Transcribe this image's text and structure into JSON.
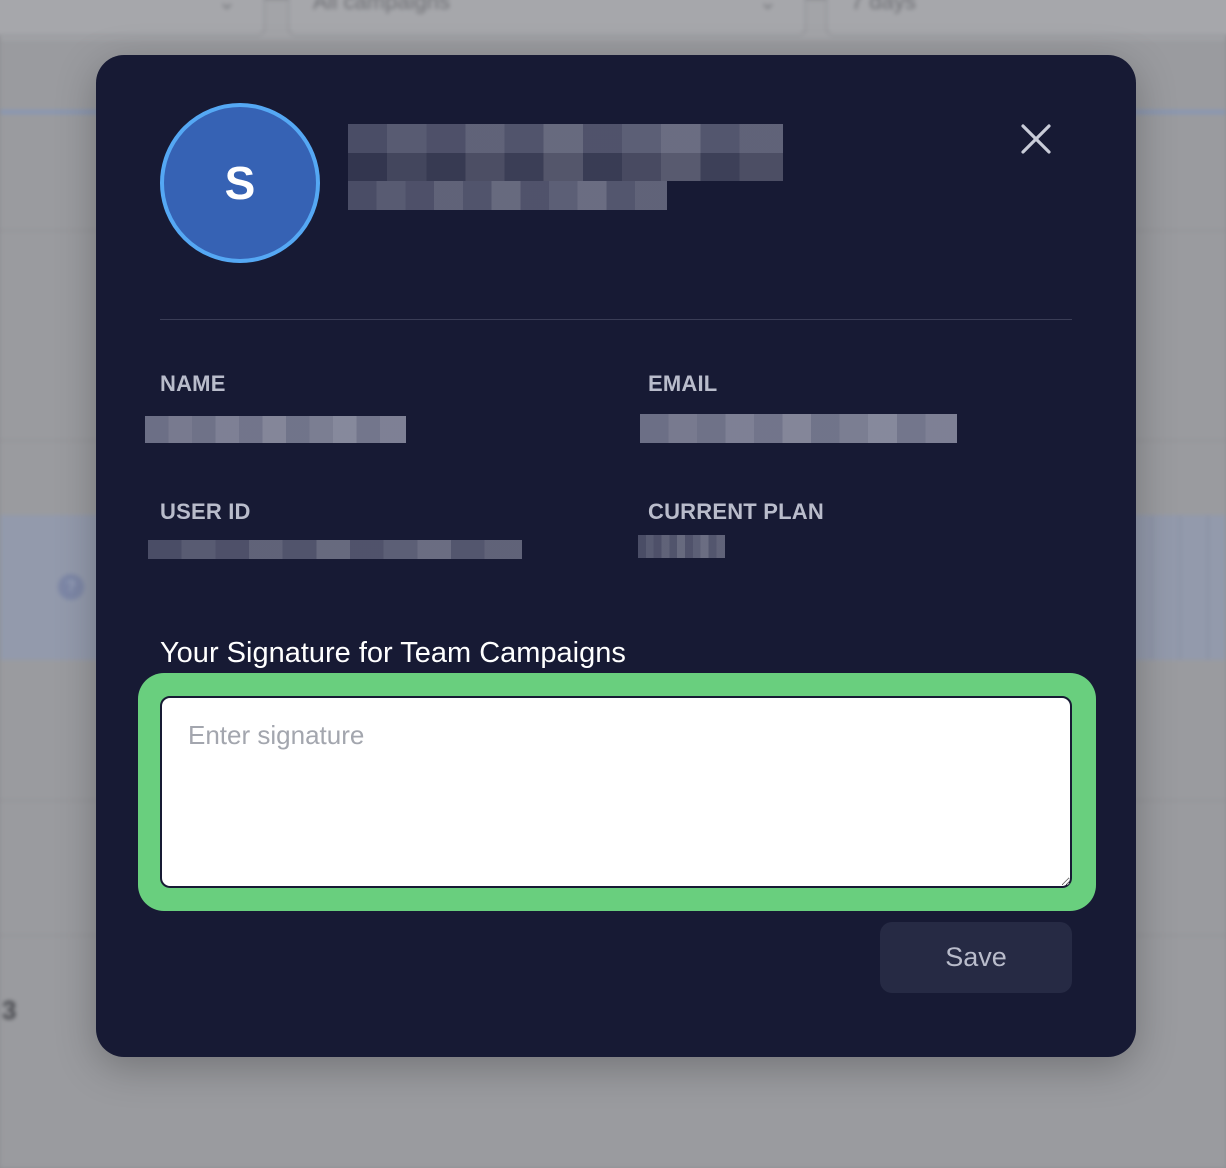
{
  "background": {
    "filter_campaigns": "All campaigns",
    "filter_range": "7 days",
    "row_number": "3"
  },
  "modal": {
    "avatar_initial": "S",
    "fields": {
      "name_label": "NAME",
      "email_label": "EMAIL",
      "user_id_label": "USER ID",
      "current_plan_label": "CURRENT PLAN"
    },
    "signature": {
      "title": "Your Signature for Team Campaigns",
      "placeholder": "Enter signature",
      "value": ""
    },
    "save_label": "Save"
  },
  "colors": {
    "modal_bg": "#171a34",
    "avatar_bg": "#3662b4",
    "avatar_ring": "#55a8f4",
    "highlight": "#69cf7e",
    "save_bg": "#262a44"
  },
  "icons": {
    "close": "close-icon"
  }
}
